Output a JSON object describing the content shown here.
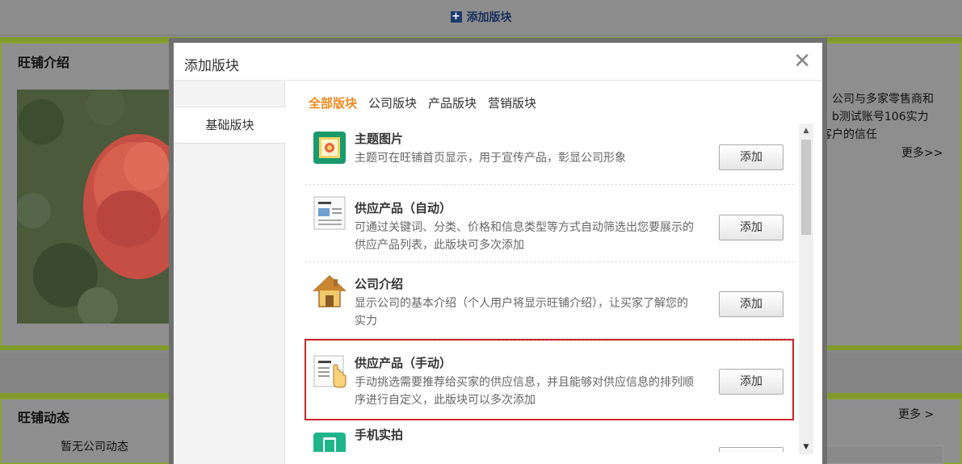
{
  "background": {
    "add_block_label": "添加版块",
    "panel1_title": "旺铺介绍",
    "panel1_text_lines": [
      "，公司与多家零售商和",
      "。b测试账号106实力",
      "客户的信任"
    ],
    "panel1_more": "更多>>",
    "panel2_title": "旺铺动态",
    "panel2_more": "更多 >",
    "panel2_empty": "暂无公司动态"
  },
  "modal": {
    "title": "添加版块",
    "close_symbol": "✕",
    "sidebar": {
      "items": [
        {
          "label": "基础版块"
        }
      ]
    },
    "tabs": [
      {
        "label": "全部版块"
      },
      {
        "label": "公司版块"
      },
      {
        "label": "产品版块"
      },
      {
        "label": "营销版块"
      }
    ],
    "items": [
      {
        "title": "主题图片",
        "desc": "主题可在旺铺首页显示，用于宣传产品，彰显公司形象",
        "button": "添加",
        "icon": "theme-image-icon"
      },
      {
        "title": "供应产品（自动）",
        "desc": "可通过关键词、分类、价格和信息类型等方式自动筛选出您要展示的供应产品列表，此版块可多次添加",
        "button": "添加",
        "icon": "product-list-icon"
      },
      {
        "title": "公司介绍",
        "desc": "显示公司的基本介绍（个人用户将显示旺铺介绍），让买家了解您的实力",
        "button": "添加",
        "icon": "house-icon"
      },
      {
        "title": "供应产品（手动）",
        "desc": "手动挑选需要推荐给买家的供应信息，并且能够对供应信息的排列顺序进行自定义，此版块可以多次添加",
        "button": "添加",
        "icon": "product-manual-icon"
      },
      {
        "title": "手机实拍",
        "desc": "",
        "button": "添加",
        "icon": "mobile-photo-icon"
      }
    ]
  },
  "colors": {
    "active_tab": "#f08a1c",
    "selected_border": "#c9252b",
    "green_frame": "#8aa13a"
  }
}
